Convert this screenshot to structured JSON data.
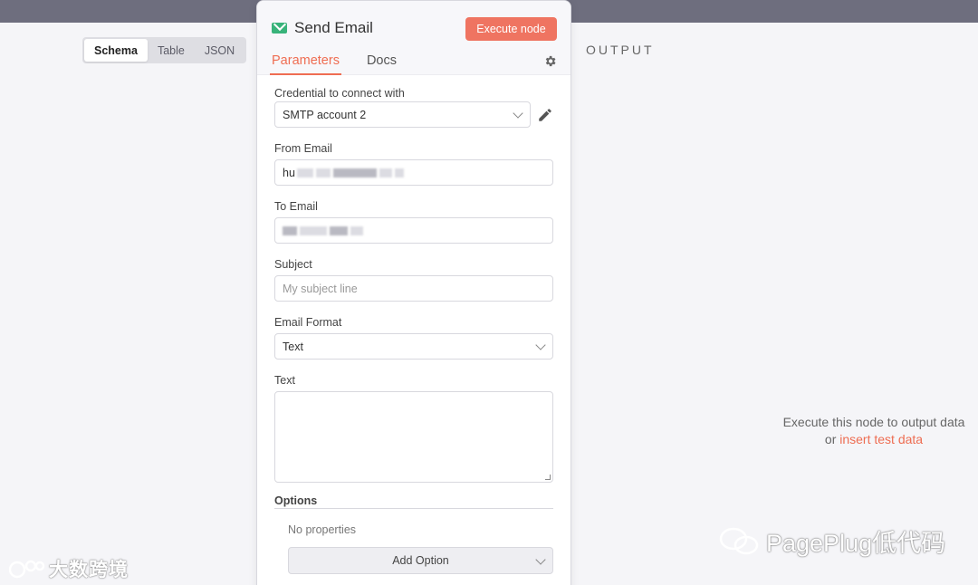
{
  "view_tabs": [
    "Schema",
    "Table",
    "JSON"
  ],
  "output": {
    "label": "OUTPUT",
    "empty_line1": "Execute this node to output data",
    "empty_or": "or",
    "empty_link": "insert test data"
  },
  "node": {
    "title": "Send Email",
    "execute_label": "Execute node",
    "tabs": [
      "Parameters",
      "Docs"
    ],
    "credential": {
      "label": "Credential to connect with",
      "value": "SMTP account 2"
    },
    "from_email": {
      "label": "From Email",
      "value_prefix": "hu"
    },
    "to_email": {
      "label": "To Email"
    },
    "subject": {
      "label": "Subject",
      "placeholder": "My subject line"
    },
    "email_format": {
      "label": "Email Format",
      "value": "Text"
    },
    "text": {
      "label": "Text"
    },
    "options": {
      "label": "Options",
      "empty": "No properties",
      "add_label": "Add Option"
    }
  },
  "watermarks": {
    "left": "大数跨境",
    "right": "PagePlug低代码"
  },
  "colors": {
    "accent": "#ef7461",
    "topbar": "#6e6e7e",
    "mail_icon": "#38b37a"
  }
}
